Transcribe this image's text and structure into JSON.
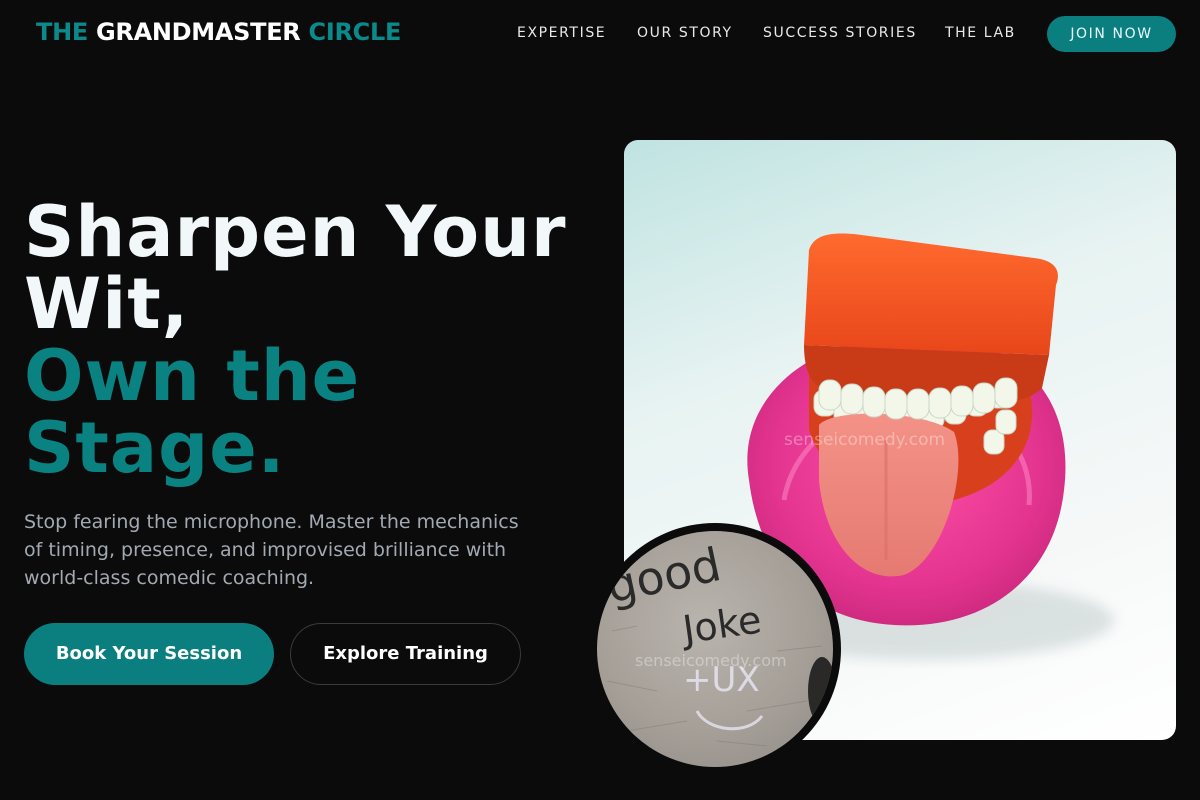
{
  "brand": {
    "part1": "THE",
    "part2": "GRANDMASTER",
    "part3": "CIRCLE"
  },
  "nav": {
    "items": [
      {
        "label": "EXPERTISE"
      },
      {
        "label": "OUR STORY"
      },
      {
        "label": "SUCCESS STORIES"
      },
      {
        "label": "THE LAB"
      }
    ],
    "cta": "JOIN NOW"
  },
  "hero": {
    "headline": [
      "Sharpen Your",
      "Wit,",
      "Own the",
      "Stage."
    ],
    "subtitle": "Stop fearing the microphone. Master the mechanics of timing, presence, and improvised brilliance with world-class comedic coaching.",
    "primary_cta": "Book Your Session",
    "secondary_cta": "Explore Training",
    "image_watermark": "senseicomedy.com",
    "inset_watermark": "senseicomedy.com",
    "inset_handwriting": [
      "good",
      "Joke",
      "+UX"
    ]
  },
  "colors": {
    "background": "#0b0b0b",
    "accent": "#0b8282",
    "text": "#f2f7fa",
    "muted": "#a3a9b2"
  }
}
